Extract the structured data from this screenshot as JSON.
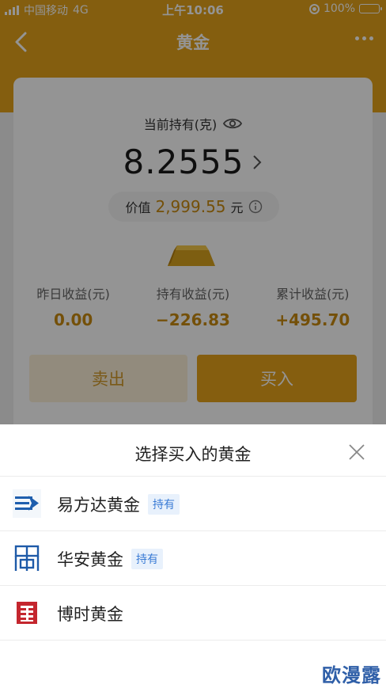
{
  "status_bar": {
    "carrier": "中国移动",
    "network": "4G",
    "time": "上午10:06",
    "battery": "100%"
  },
  "nav": {
    "title": "黄金",
    "back_icon": "chevron-left-icon",
    "more_icon": "more-dots-icon"
  },
  "holding": {
    "label": "当前持有(克)",
    "value": "8.2555",
    "value_label": "价值",
    "value_amount": "2,999.55",
    "value_unit": "元"
  },
  "stats": [
    {
      "label": "昨日收益(元)",
      "value": "0.00"
    },
    {
      "label": "持有收益(元)",
      "value": "−226.83"
    },
    {
      "label": "累计收益(元)",
      "value": "+495.70"
    }
  ],
  "actions": {
    "sell_label": "卖出",
    "buy_label": "买入"
  },
  "sheet": {
    "title": "选择买入的黄金",
    "funds": [
      {
        "name": "易方达黄金",
        "badge": "持有",
        "logo": "efund-logo"
      },
      {
        "name": "华安黄金",
        "badge": "持有",
        "logo": "huaan-logo"
      },
      {
        "name": "博时黄金",
        "badge": "",
        "logo": "bosera-logo"
      }
    ]
  },
  "watermark": "欧漫露",
  "colors": {
    "brand_gold": "#e3a31a",
    "amount_gold": "#c98a10",
    "badge_blue": "#3a7bd5"
  }
}
